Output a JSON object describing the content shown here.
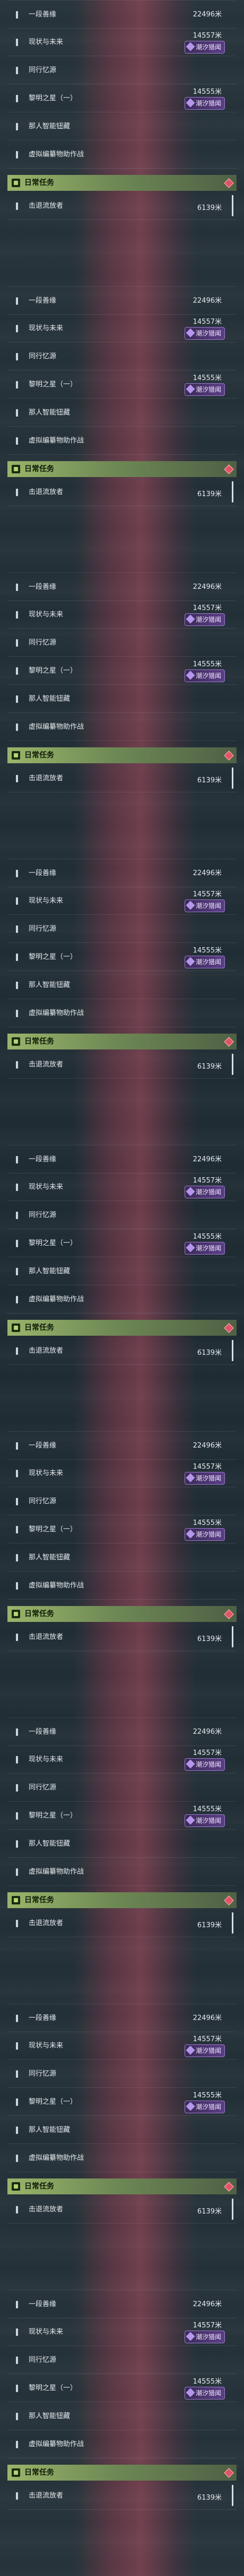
{
  "tasks": [
    {
      "label": "一段善缘",
      "value": "22496米"
    },
    {
      "label": "现状与未来",
      "value": "14557米",
      "badge": "潮汐猎闻"
    },
    {
      "label": "同行忆源",
      "value": ""
    },
    {
      "label": "黎明之星（一）",
      "value": "14555米",
      "badge": "潮汐猎闻"
    },
    {
      "label": "那人智能钮藏",
      "value": ""
    },
    {
      "label": "虚拟编纂物助作战",
      "value": ""
    }
  ],
  "section_title": "日常任务",
  "daily_task": {
    "label": "击退流放者",
    "value": "6139米"
  }
}
